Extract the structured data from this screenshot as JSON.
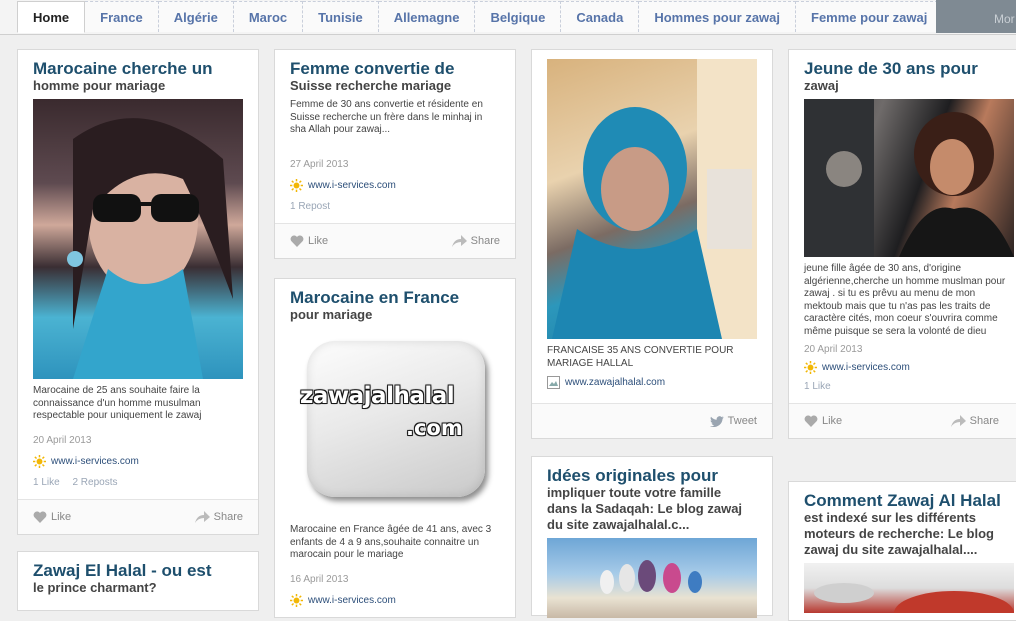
{
  "nav": {
    "tabs": [
      "Home",
      "France",
      "Algérie",
      "Maroc",
      "Tunisie",
      "Allemagne",
      "Belgique",
      "Canada",
      "Hommes pour zawaj",
      "Femme pour zawaj"
    ],
    "more_label": "Mor"
  },
  "actions": {
    "like": "Like",
    "share": "Share",
    "tweet": "Tweet"
  },
  "pins": {
    "p1": {
      "title": "Marocaine cherche un",
      "subtitle": "homme pour mariage",
      "desc": "Marocaine de 25 ans souhaite faire la connaissance d'un homme musulman respectable pour uniquement le zawaj",
      "date": "20 April 2013",
      "source": "www.i-services.com",
      "stat_likes": "1 Like",
      "stat_reposts": "2 Reposts"
    },
    "p2": {
      "title": "Femme convertie de",
      "subtitle": "Suisse recherche mariage",
      "desc": "Femme de 30 ans convertie et résidente en Suisse recherche un frère dans le minhaj in sha Allah pour zawaj...",
      "date": "27 April 2013",
      "source": "www.i-services.com",
      "stat_reposts": "1 Repost"
    },
    "p3": {
      "title": "Marocaine en France",
      "subtitle": "pour mariage",
      "logo_line1": "zawajalhalal",
      "logo_line2": ".com",
      "desc": "Marocaine en France âgée de 41 ans, avec 3 enfants de 4 a 9 ans,souhaite connaitre un marocain pour le mariage",
      "date": "16 April 2013",
      "source": "www.i-services.com"
    },
    "p4": {
      "title": "Zawaj El Halal - ou est",
      "subtitle": "le prince charmant?"
    },
    "p5": {
      "desc": "FRANCAISE 35 ANS CONVERTIE POUR MARIAGE HALLAL",
      "source": "www.zawajalhalal.com"
    },
    "p6": {
      "title": "Idées originales pour",
      "subtitle_lines": [
        "impliquer toute votre famille",
        "dans la Sadaqah: Le blog zawaj",
        "du site zawajalhalal.c..."
      ]
    },
    "p7": {
      "title": "Jeune de 30 ans pour",
      "subtitle": "zawaj",
      "desc": "jeune fille âgée de 30 ans, d'origine algérienne,cherche un homme muslman pour zawaj . si tu es prêvu au menu de mon mektoub mais que tu n'as pas les traits de caractère cités, mon coeur s'ouvrira comme même puisque se sera la volonté de dieu",
      "date": "20 April 2013",
      "source": "www.i-services.com",
      "stat_likes": "1 Like"
    },
    "p8": {
      "title": "Comment Zawaj Al Halal",
      "subtitle_lines": [
        "est indexé sur les différents",
        "moteurs de recherche: Le blog",
        "zawaj du site zawajalhalal...."
      ]
    }
  }
}
